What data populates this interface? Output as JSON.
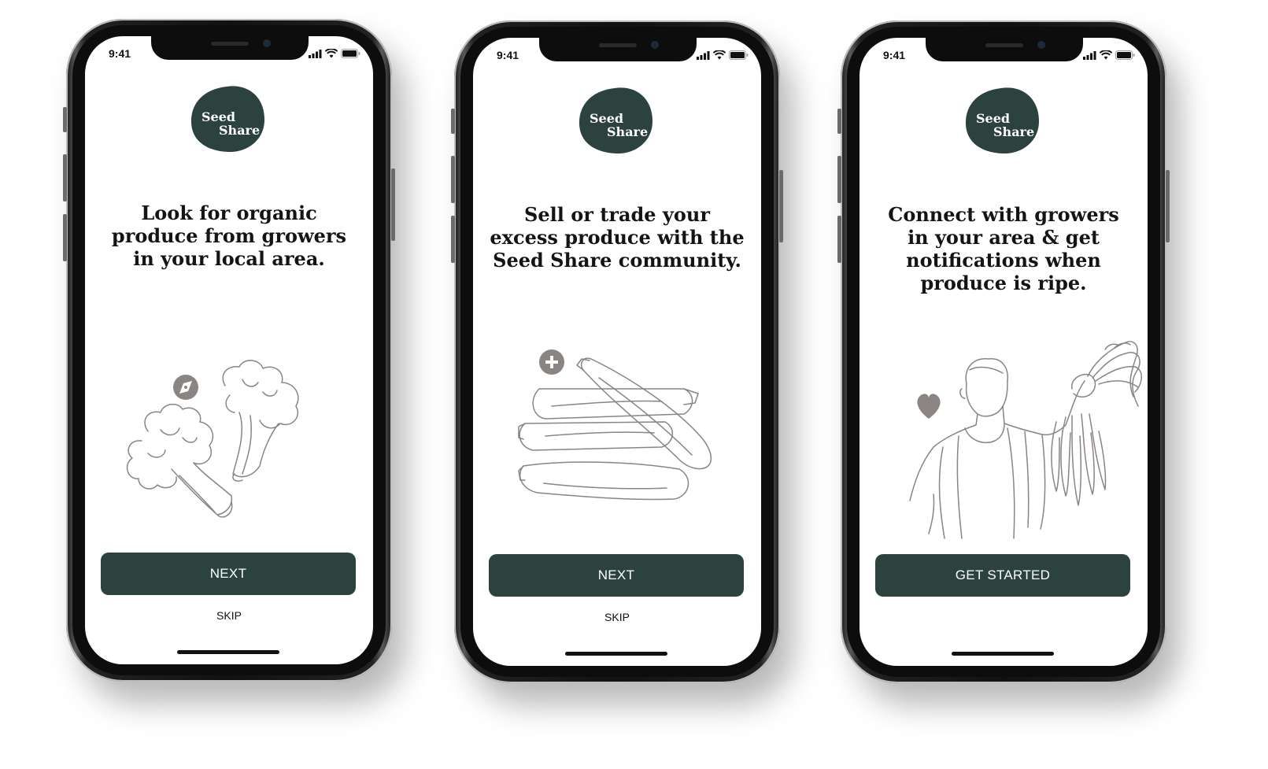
{
  "colors": {
    "brand": "#2c423e",
    "illustration": "#8a8482",
    "icon_badge": "#8a8482"
  },
  "screens": [
    {
      "status": {
        "time": "9:41"
      },
      "logo": {
        "line1": "Seed",
        "line2": "Share"
      },
      "headline": "Look for organic produce from growers in your local area.",
      "illustration_icon": "compass-icon",
      "illustration": "broccoli",
      "primary_button": "NEXT",
      "skip": "SKIP"
    },
    {
      "status": {
        "time": "9:41"
      },
      "logo": {
        "line1": "Seed",
        "line2": "Share"
      },
      "headline": "Sell or trade your excess produce with the Seed Share community.",
      "illustration_icon": "plus-icon",
      "illustration": "zucchini",
      "primary_button": "NEXT",
      "skip": "SKIP"
    },
    {
      "status": {
        "time": "9:41"
      },
      "logo": {
        "line1": "Seed",
        "line2": "Share"
      },
      "headline": "Connect with growers in your area & get notifications when produce is ripe.",
      "illustration_icon": "heart-icon",
      "illustration": "person-with-carrots",
      "primary_button": "GET STARTED",
      "skip": ""
    }
  ]
}
